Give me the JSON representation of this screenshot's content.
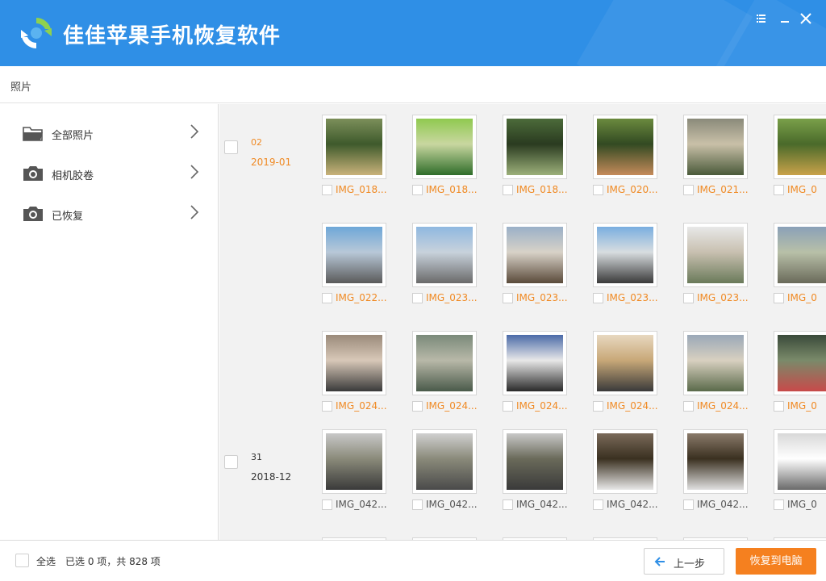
{
  "app": {
    "title": "佳佳苹果手机恢复软件"
  },
  "breadcrumb": {
    "label": "照片"
  },
  "sidebar": {
    "items": [
      {
        "label": "全部照片",
        "icon": "folder-icon"
      },
      {
        "label": "相机胶卷",
        "icon": "camera-icon"
      },
      {
        "label": "已恢复",
        "icon": "camera-icon"
      }
    ]
  },
  "groups": [
    {
      "day": "02",
      "month": "2019-01",
      "color": "#f08a24"
    },
    {
      "day": "31",
      "month": "2018-12",
      "color": "#333333"
    }
  ],
  "rows": [
    {
      "color": "#f08a24",
      "captions": [
        "IMG_018...",
        "IMG_018...",
        "IMG_018...",
        "IMG_020...",
        "IMG_021...",
        "IMG_0"
      ]
    },
    {
      "color": "#f08a24",
      "captions": [
        "IMG_022...",
        "IMG_023...",
        "IMG_023...",
        "IMG_023...",
        "IMG_023...",
        "IMG_0"
      ]
    },
    {
      "color": "#f08a24",
      "captions": [
        "IMG_024...",
        "IMG_024...",
        "IMG_024...",
        "IMG_024...",
        "IMG_024...",
        "IMG_0"
      ]
    },
    {
      "color": "#555555",
      "captions": [
        "IMG_042...",
        "IMG_042...",
        "IMG_042...",
        "IMG_042...",
        "IMG_042...",
        "IMG_0"
      ]
    }
  ],
  "footer": {
    "select_all": "全选",
    "status": "已选 0 项，共 828 项",
    "prev": "上一步",
    "recover": "恢复到电脑"
  },
  "colors": {
    "header": "#2f8fe6",
    "accent": "#f08a24",
    "recover_button": "#f5801f"
  }
}
